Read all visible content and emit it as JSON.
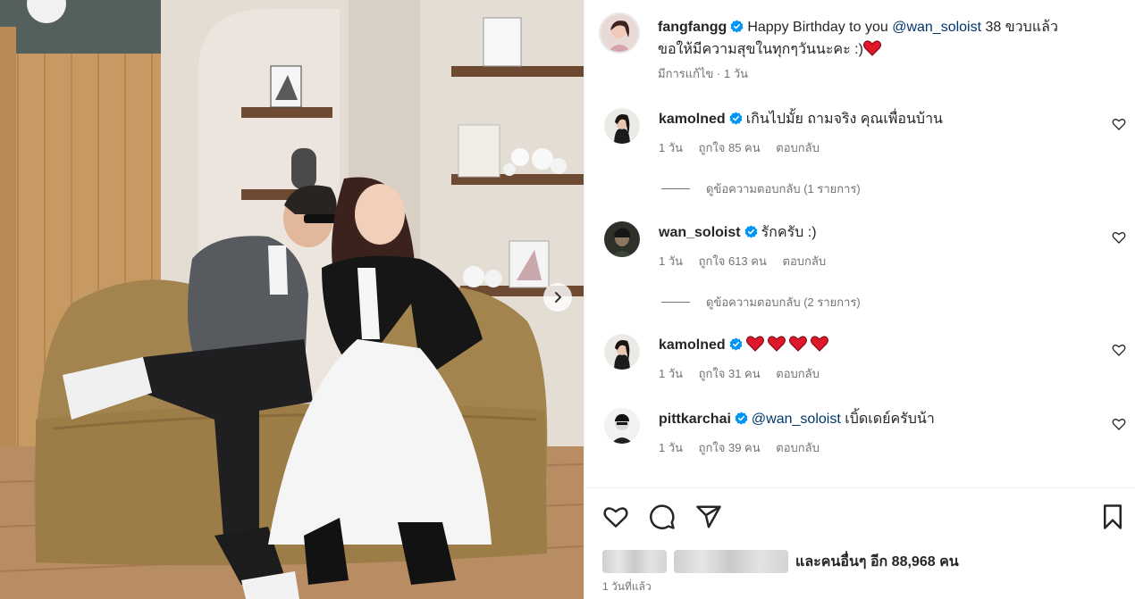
{
  "post": {
    "author": "fangfangg",
    "caption_main": "Happy Birthday to you",
    "caption_mention": "@wan_soloist",
    "caption_rest": "38 ขวบแล้ว",
    "caption_line2": "ขอให้มีความสุขในทุกๆวันนะคะ :)",
    "edited": "มีการแก้ไข",
    "time": "1 วัน"
  },
  "comments": [
    {
      "username": "kamolned",
      "text": "เกินไปมั้ย ถามจริง คุณเพื่อนบ้าน",
      "time": "1 วัน",
      "likes": "ถูกใจ 85 คน",
      "reply": "ตอบกลับ",
      "view_replies": "ดูข้อความตอบกลับ (1 รายการ)"
    },
    {
      "username": "wan_soloist",
      "text": "รักครับ :)",
      "time": "1 วัน",
      "likes": "ถูกใจ 613 คน",
      "reply": "ตอบกลับ",
      "view_replies": "ดูข้อความตอบกลับ (2 รายการ)"
    },
    {
      "username": "kamolned",
      "text": "",
      "time": "1 วัน",
      "likes": "ถูกใจ 31 คน",
      "reply": "ตอบกลับ"
    },
    {
      "username": "pittkarchai",
      "mention": "@wan_soloist",
      "text": "เบิ้ดเดย์ครับน้า",
      "time": "1 วัน",
      "likes": "ถูกใจ 39 คน",
      "reply": "ตอบกลับ"
    }
  ],
  "footer": {
    "likes_text": "และคนอื่นๆ อีก 88,968 คน",
    "date": "1 วันที่แล้ว"
  },
  "icons": {
    "like": "heart-icon",
    "comment": "comment-icon",
    "share": "share-icon",
    "save": "bookmark-icon",
    "verified": "verified-badge-icon",
    "next": "chevron-right-icon"
  },
  "colors": {
    "verified": "#0095f6",
    "mention": "#00376b",
    "heart_emoji": "#e0162b",
    "muted": "#737373"
  }
}
